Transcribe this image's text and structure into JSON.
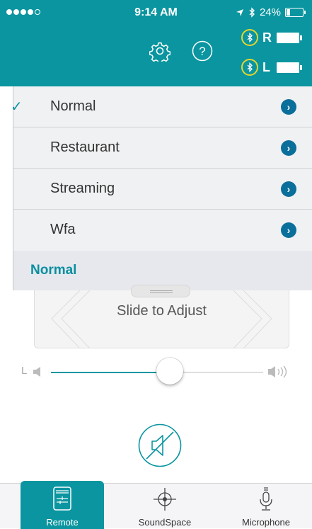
{
  "status": {
    "time": "9:14 AM",
    "battery_percent": "24%",
    "battery_level": 0.24
  },
  "header": {
    "devices": [
      {
        "side": "R",
        "connection_icon": "bluetooth-icon"
      },
      {
        "side": "L",
        "connection_icon": "bluetooth-icon"
      }
    ],
    "icons": [
      "gear-icon",
      "help-icon"
    ]
  },
  "programs": [
    {
      "label": "Normal",
      "selected": true
    },
    {
      "label": "Restaurant",
      "selected": false
    },
    {
      "label": "Streaming",
      "selected": false
    },
    {
      "label": "Wfa",
      "selected": false
    }
  ],
  "current_program": "Normal",
  "adjust": {
    "label": "Slide to Adjust"
  },
  "volume": {
    "side_label": "L",
    "level": 0.5
  },
  "tabs": [
    {
      "label": "Remote",
      "active": true,
      "icon": "remote-icon"
    },
    {
      "label": "SoundSpace",
      "active": false,
      "icon": "crosshair-icon"
    },
    {
      "label": "Microphone",
      "active": false,
      "icon": "microphone-icon"
    }
  ],
  "colors": {
    "accent": "#0a95a0",
    "highlight": "#e5d62b",
    "chevron": "#0a6f9a"
  }
}
